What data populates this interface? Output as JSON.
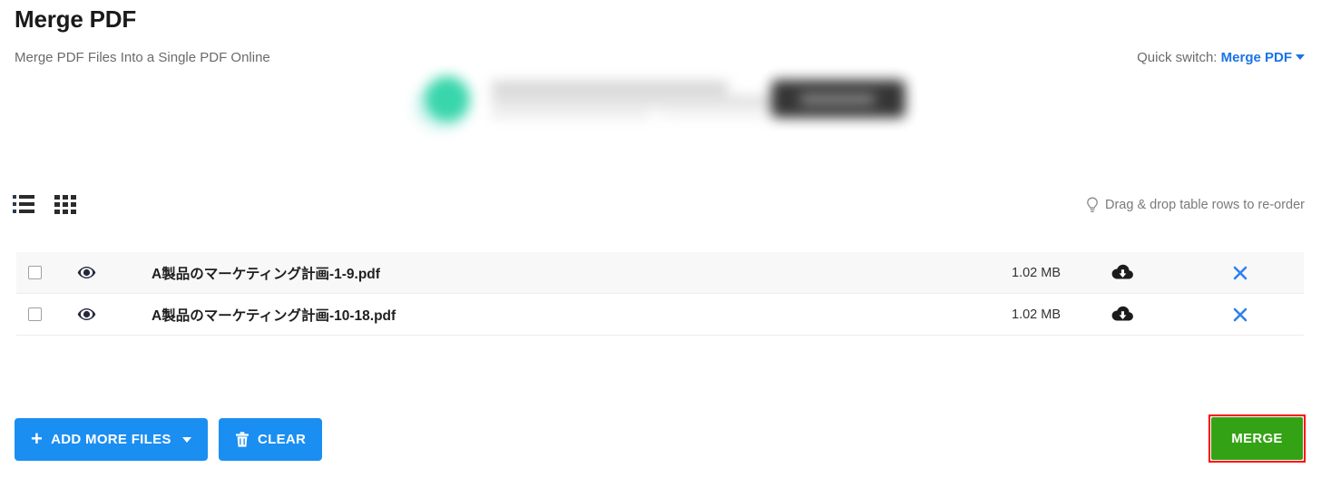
{
  "header": {
    "title": "Merge PDF",
    "subtitle": "Merge PDF Files Into a Single PDF Online",
    "quick_switch_label": "Quick switch:",
    "quick_switch_value": "Merge PDF"
  },
  "toolbar": {
    "list_view_icon": "list-view-icon",
    "grid_view_icon": "grid-view-icon",
    "hint_icon": "lightbulb-icon",
    "hint_text": "Drag & drop table rows to re-order"
  },
  "table": {
    "rows": [
      {
        "name": "A製品のマーケティング計画-1-9.pdf",
        "size": "1.02 MB",
        "checked": false,
        "preview_icon": "eye-icon",
        "download_icon": "cloud-download-icon",
        "remove_icon": "close-icon"
      },
      {
        "name": "A製品のマーケティング計画-10-18.pdf",
        "size": "1.02 MB",
        "checked": false,
        "preview_icon": "eye-icon",
        "download_icon": "cloud-download-icon",
        "remove_icon": "close-icon"
      }
    ]
  },
  "actions": {
    "add_more_label": "ADD MORE FILES",
    "add_more_plus": "+",
    "clear_label": "CLEAR",
    "merge_label": "MERGE"
  },
  "colors": {
    "primary_blue": "#1b8ef2",
    "link_blue": "#1a73e8",
    "merge_green": "#34a215",
    "highlight_red": "#ff0000",
    "row_shade": "#f8f8f8"
  }
}
